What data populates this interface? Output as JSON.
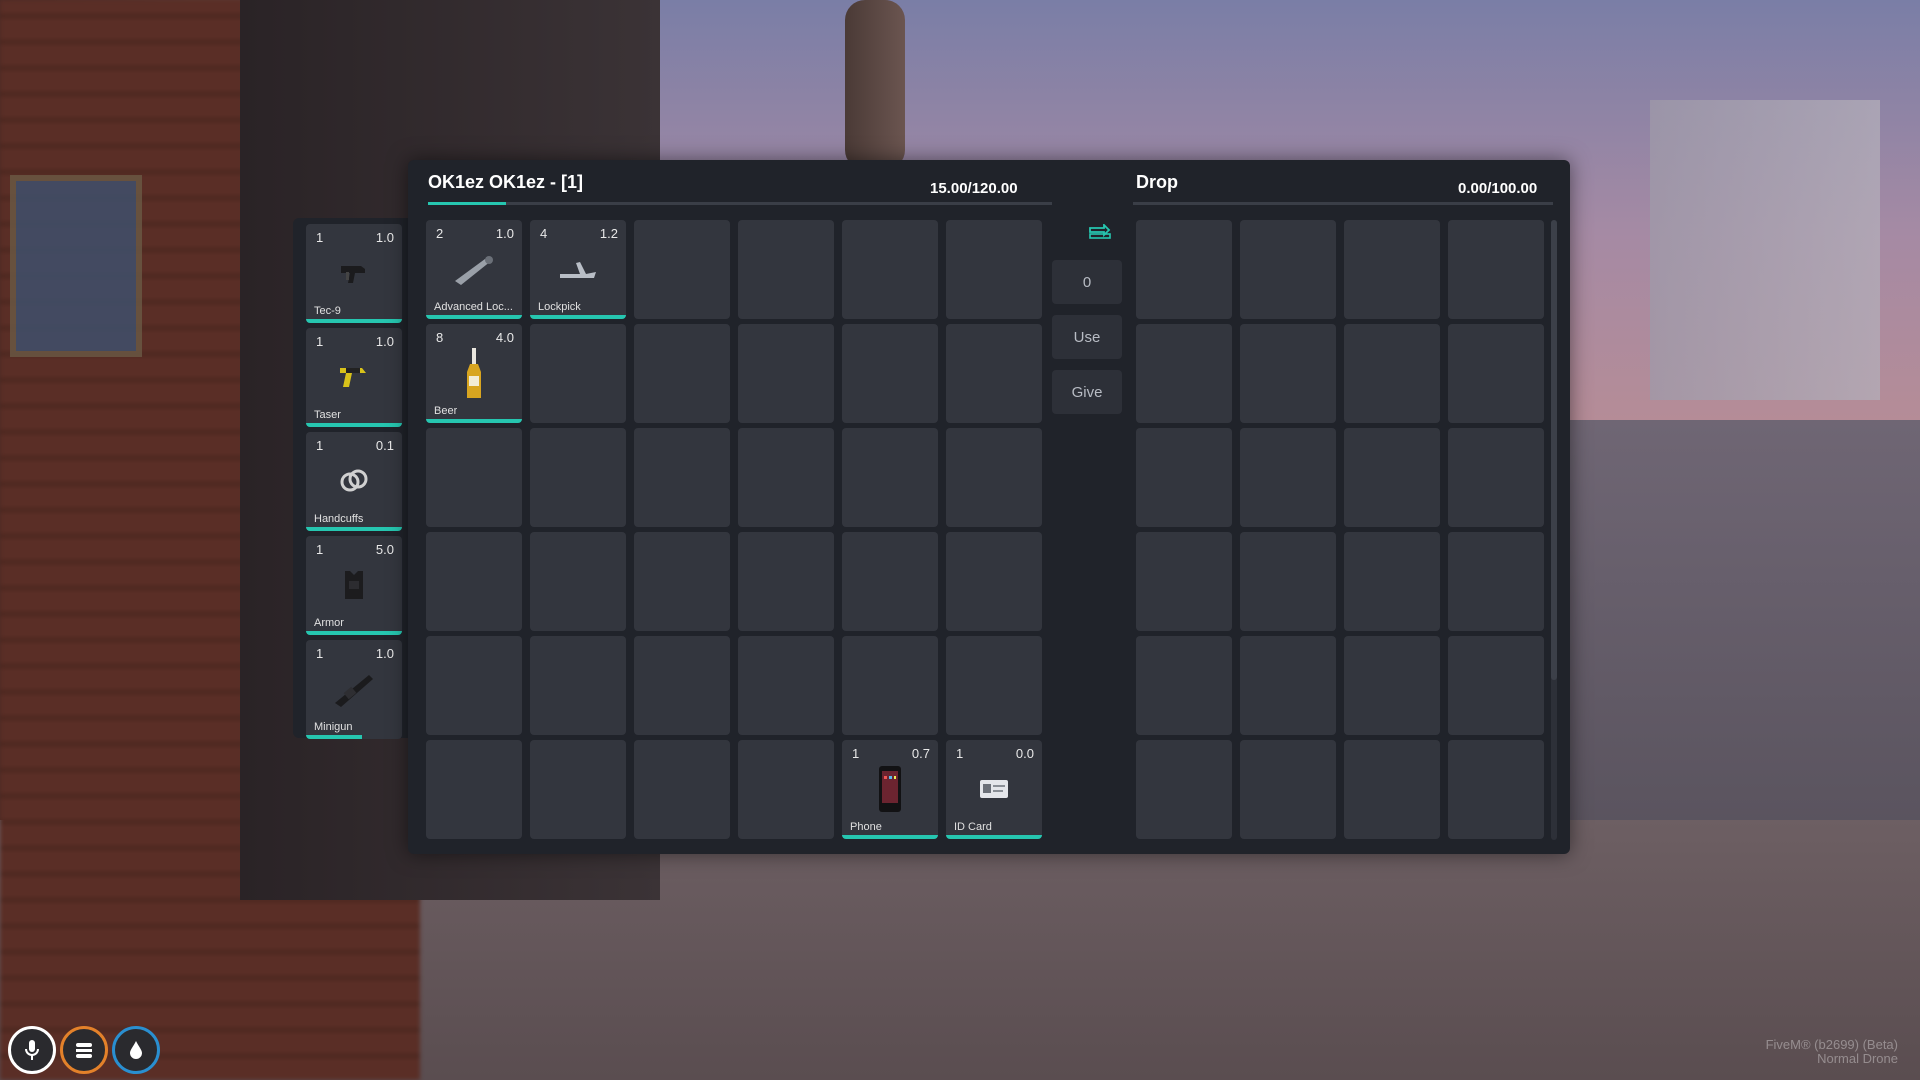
{
  "player_inventory": {
    "title": "OK1ez OK1ez - [1]",
    "weight": "15.00/120.00",
    "weight_fill": 0.125
  },
  "drop_inventory": {
    "title": "Drop",
    "weight": "0.00/100.00"
  },
  "hotbar": [
    {
      "qty": "1",
      "weight": "1.0",
      "name": "Tec-9",
      "icon": "smg-icon"
    },
    {
      "qty": "1",
      "weight": "1.0",
      "name": "Taser",
      "icon": "taser-icon"
    },
    {
      "qty": "1",
      "weight": "0.1",
      "name": "Handcuffs",
      "icon": "handcuffs-icon"
    },
    {
      "qty": "1",
      "weight": "5.0",
      "name": "Armor",
      "icon": "armor-icon"
    },
    {
      "qty": "1",
      "weight": "1.0",
      "name": "Minigun",
      "icon": "minigun-icon"
    }
  ],
  "items": [
    {
      "qty": "2",
      "weight": "1.0",
      "name": "Advanced Loc...",
      "icon": "advanced-lockpick-icon"
    },
    {
      "qty": "4",
      "weight": "1.2",
      "name": "Lockpick",
      "icon": "lockpick-icon"
    },
    {
      "qty": "8",
      "weight": "4.0",
      "name": "Beer",
      "icon": "beer-bottle-icon"
    },
    {
      "qty": "1",
      "weight": "0.7",
      "name": "Phone",
      "icon": "phone-icon"
    },
    {
      "qty": "1",
      "weight": "0.0",
      "name": "ID Card",
      "icon": "id-card-icon"
    }
  ],
  "controls": {
    "swap_icon": "swap-icon",
    "amount_value": "0",
    "use_label": "Use",
    "give_label": "Give"
  },
  "hud": [
    "microphone-icon",
    "food-icon",
    "water-icon"
  ],
  "watermark": {
    "line1": "FiveM® (b2699) (Beta)",
    "line2": "Normal Drone"
  },
  "colors": {
    "accent": "#26c6b0",
    "panel": "#20232a",
    "slot": "#33363e"
  }
}
